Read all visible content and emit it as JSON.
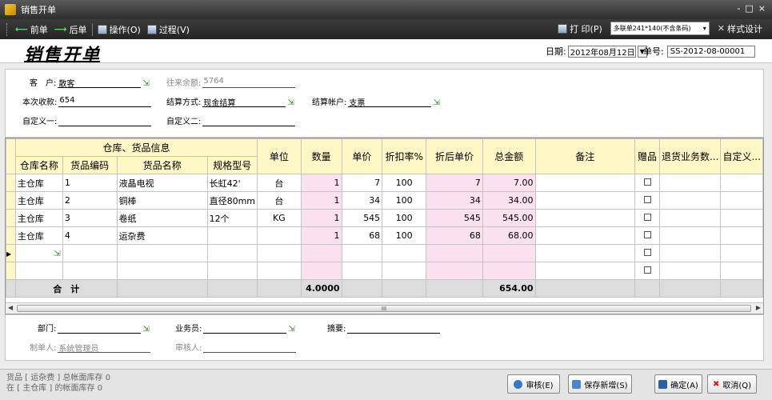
{
  "window": {
    "title": "销售开单",
    "controls": [
      "-",
      "□",
      "×"
    ]
  },
  "toolbar": {
    "prev": "前单",
    "next": "后单",
    "operate": "操作(O)",
    "process": "过程(V)",
    "print": "打 印(P)",
    "print_template": "多联单241*140(不含条码)",
    "style_design": "样式设计"
  },
  "header": {
    "title": "销售开单",
    "date_label": "日期:",
    "date_value": "2012年08月12日",
    "number_label": "单号:",
    "number_value": "SS-2012-08-00001"
  },
  "top_form": {
    "customer": {
      "label": "客　户:",
      "value": "散客"
    },
    "prev_balance": {
      "label": "往来余额:",
      "value": "5764"
    },
    "received": {
      "label": "本次收款:",
      "value": "654"
    },
    "settle_method": {
      "label": "结算方式:",
      "value": "现金结算"
    },
    "settle_account": {
      "label": "结算帐户:",
      "value": "支票"
    },
    "custom1": {
      "label": "自定义一:",
      "value": ""
    },
    "custom2": {
      "label": "自定义二:",
      "value": ""
    }
  },
  "grid": {
    "group_header": "仓库、货品信息",
    "columns": {
      "warehouse": "仓库名称",
      "code": "货品编码",
      "name": "货品名称",
      "spec": "规格型号",
      "unit": "单位",
      "qty": "数量",
      "price": "单价",
      "discount": "折扣率%",
      "disc_price": "折后单价",
      "amount": "总金额",
      "remark": "备注",
      "gift": "赠品",
      "return_no": "退货业务数...",
      "custom": "自定义..."
    },
    "rows": [
      {
        "warehouse": "主仓库",
        "code": "1",
        "name": "液晶电视",
        "spec": "长虹42'",
        "unit": "台",
        "qty": "1",
        "price": "7",
        "discount": "100",
        "disc_price": "7",
        "amount": "7.00"
      },
      {
        "warehouse": "主仓库",
        "code": "2",
        "name": "铜棒",
        "spec": "直径80mm",
        "unit": "台",
        "qty": "1",
        "price": "34",
        "discount": "100",
        "disc_price": "34",
        "amount": "34.00"
      },
      {
        "warehouse": "主仓库",
        "code": "3",
        "name": "卷纸",
        "spec": "12个",
        "unit": "KG",
        "qty": "1",
        "price": "545",
        "discount": "100",
        "disc_price": "545",
        "amount": "545.00"
      },
      {
        "warehouse": "主仓库",
        "code": "4",
        "name": "运杂费",
        "spec": "",
        "unit": "",
        "qty": "1",
        "price": "68",
        "discount": "100",
        "disc_price": "68",
        "amount": "68.00"
      }
    ],
    "total": {
      "label": "合　计",
      "qty": "4.0000",
      "amount": "654.00"
    },
    "scroll_grip": "III"
  },
  "bottom_form": {
    "dept": {
      "label": "部门:",
      "value": ""
    },
    "salesman": {
      "label": "业务员:",
      "value": ""
    },
    "summary": {
      "label": "摘要:",
      "value": ""
    },
    "creator": {
      "label": "制单人:",
      "value": "系统管理员"
    },
    "reviewer": {
      "label": "审核人:",
      "value": ""
    }
  },
  "status": {
    "line1": "货品 [ 运杂费 ] 总帐面库存 0",
    "line2": "在 [ 主仓库 ] 的帐面库存 0"
  },
  "buttons": {
    "audit": "审核(E)",
    "save_new": "保存新增(S)",
    "ok": "确定(A)",
    "cancel": "取消(Q)"
  }
}
